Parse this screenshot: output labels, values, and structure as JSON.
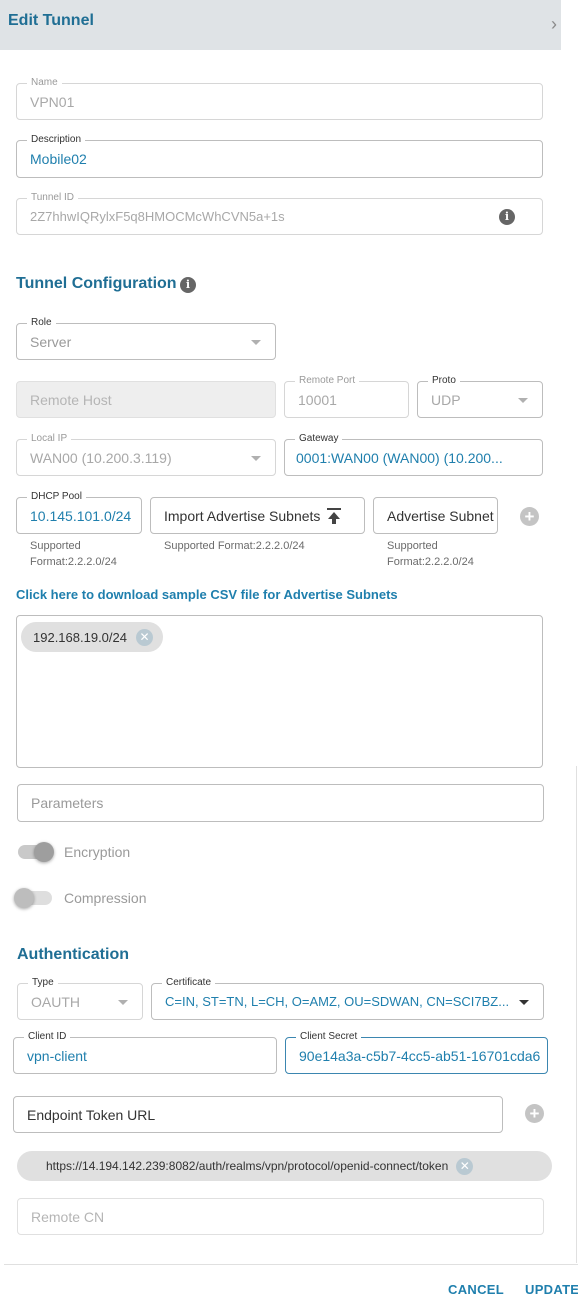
{
  "header": {
    "title": "Edit Tunnel",
    "close_icon": "chevron-right-icon"
  },
  "name": {
    "label": "Name",
    "value": "VPN01"
  },
  "description": {
    "label": "Description",
    "value": "Mobile02"
  },
  "tunnel_id": {
    "label": "Tunnel ID",
    "value": "2Z7hhwIQRylxF5q8HMOCMcWhCVN5a+1s"
  },
  "tunnel_config": {
    "title": "Tunnel Configuration",
    "role": {
      "label": "Role",
      "value": "Server"
    },
    "remote_host": {
      "placeholder": "Remote Host"
    },
    "remote_port": {
      "label": "Remote Port",
      "value": "10001"
    },
    "proto": {
      "label": "Proto",
      "value": "UDP"
    },
    "local_ip": {
      "label": "Local IP",
      "value": "WAN00 (10.200.3.119)"
    },
    "gateway": {
      "label": "Gateway",
      "value": "0001:WAN00 (WAN00) (10.200..."
    },
    "dhcp_pool": {
      "label": "DHCP Pool",
      "value": "10.145.101.0/24",
      "hint": "Supported Format:2.2.2.0/24"
    },
    "import_advertise": {
      "label": "Import Advertise Subnets",
      "hint": "Supported Format:2.2.2.0/24"
    },
    "advertise_subnet": {
      "label": "Advertise Subnet",
      "hint": "Supported Format:2.2.2.0/24"
    },
    "csv_link": "Click here to download sample CSV file for Advertise Subnets",
    "subnets": [
      "192.168.19.0/24"
    ],
    "parameters": {
      "placeholder": "Parameters"
    },
    "encryption": {
      "label": "Encryption",
      "on": true
    },
    "compression": {
      "label": "Compression",
      "on": false
    }
  },
  "authentication": {
    "title": "Authentication",
    "type": {
      "label": "Type",
      "value": "OAUTH"
    },
    "certificate": {
      "label": "Certificate",
      "value": "C=IN, ST=TN, L=CH, O=AMZ, OU=SDWAN, CN=SCI7BZ..."
    },
    "client_id": {
      "label": "Client ID",
      "value": "vpn-client"
    },
    "client_secret": {
      "label": "Client Secret",
      "value": "90e14a3a-c5b7-4cc5-ab51-16701cda6"
    },
    "endpoint_token_url": {
      "placeholder": "Endpoint Token URL"
    },
    "token_urls": [
      "https://14.194.142.239:8082/auth/realms/vpn/protocol/openid-connect/token"
    ],
    "remote_cn": {
      "placeholder": "Remote CN"
    }
  },
  "footer": {
    "cancel": "CANCEL",
    "update": "UPDATE"
  },
  "colors": {
    "accent": "#1f7fad",
    "header_bg": "#dfe3e6",
    "title": "#1f6e94"
  }
}
